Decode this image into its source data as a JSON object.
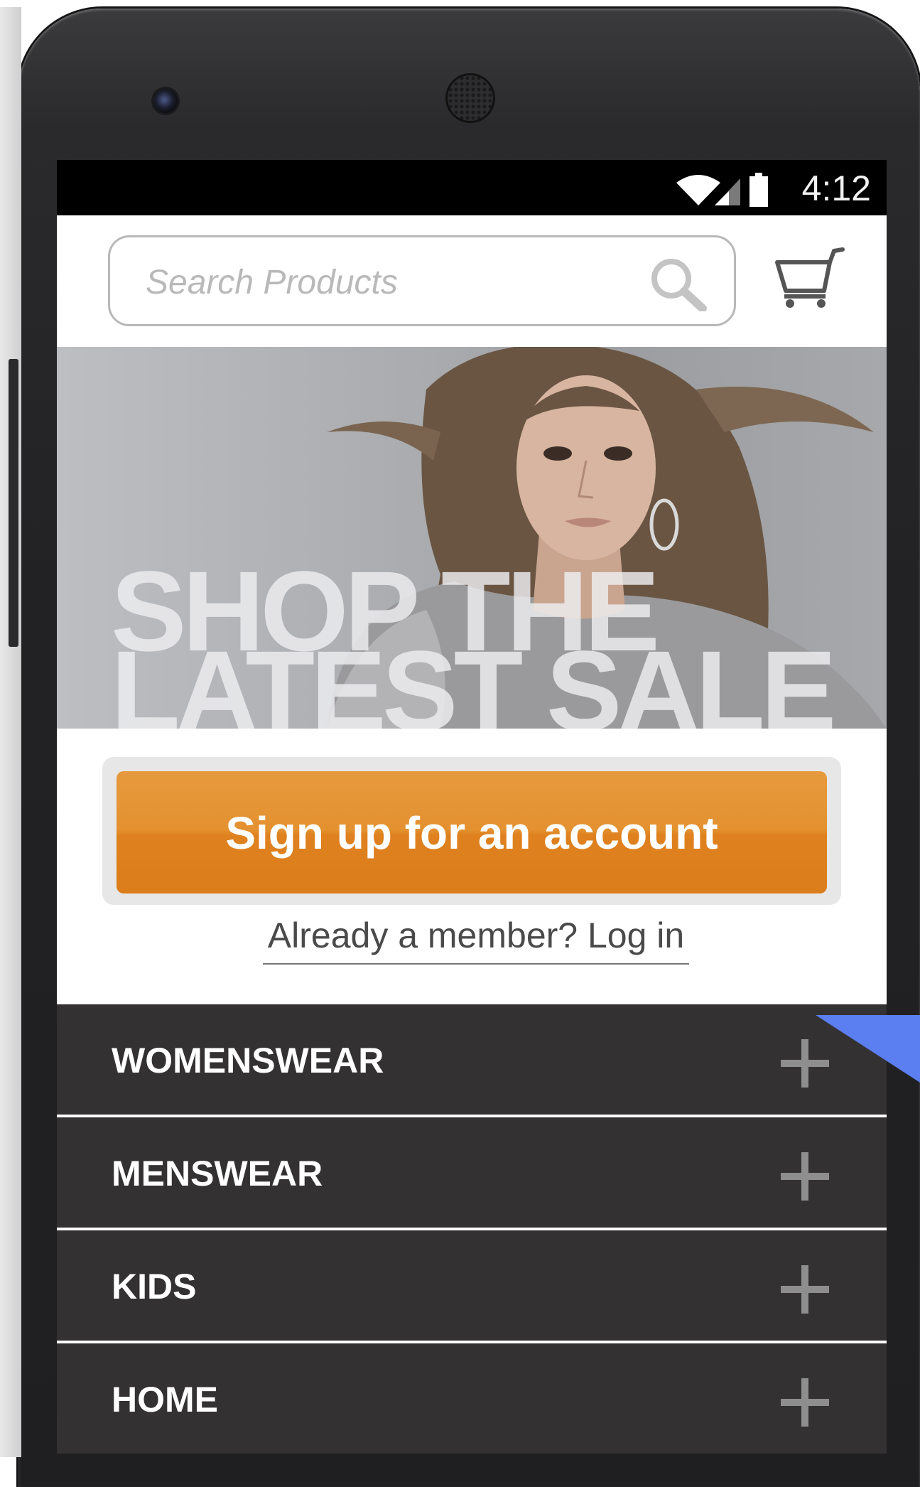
{
  "status_bar": {
    "time": "4:12",
    "icons": [
      "wifi-icon",
      "signal-icon",
      "battery-icon"
    ]
  },
  "header": {
    "search": {
      "placeholder": "Search Products",
      "icon": "search-icon"
    },
    "cart_icon": "cart-icon"
  },
  "hero": {
    "line1": "SHOP THE",
    "line2": "LATEST SALE"
  },
  "signup": {
    "button_label": "Sign up for an account",
    "login_text": "Already a member? Log in"
  },
  "menu": {
    "items": [
      {
        "label": "WOMENSWEAR",
        "icon": "plus-icon"
      },
      {
        "label": "MENSWEAR",
        "icon": "plus-icon"
      },
      {
        "label": "KIDS",
        "icon": "plus-icon"
      },
      {
        "label": "HOME",
        "icon": "plus-icon"
      }
    ]
  },
  "colors": {
    "accent_orange": "#e49130",
    "menu_background": "#333132",
    "corner_tab": "#5b7ef0"
  }
}
